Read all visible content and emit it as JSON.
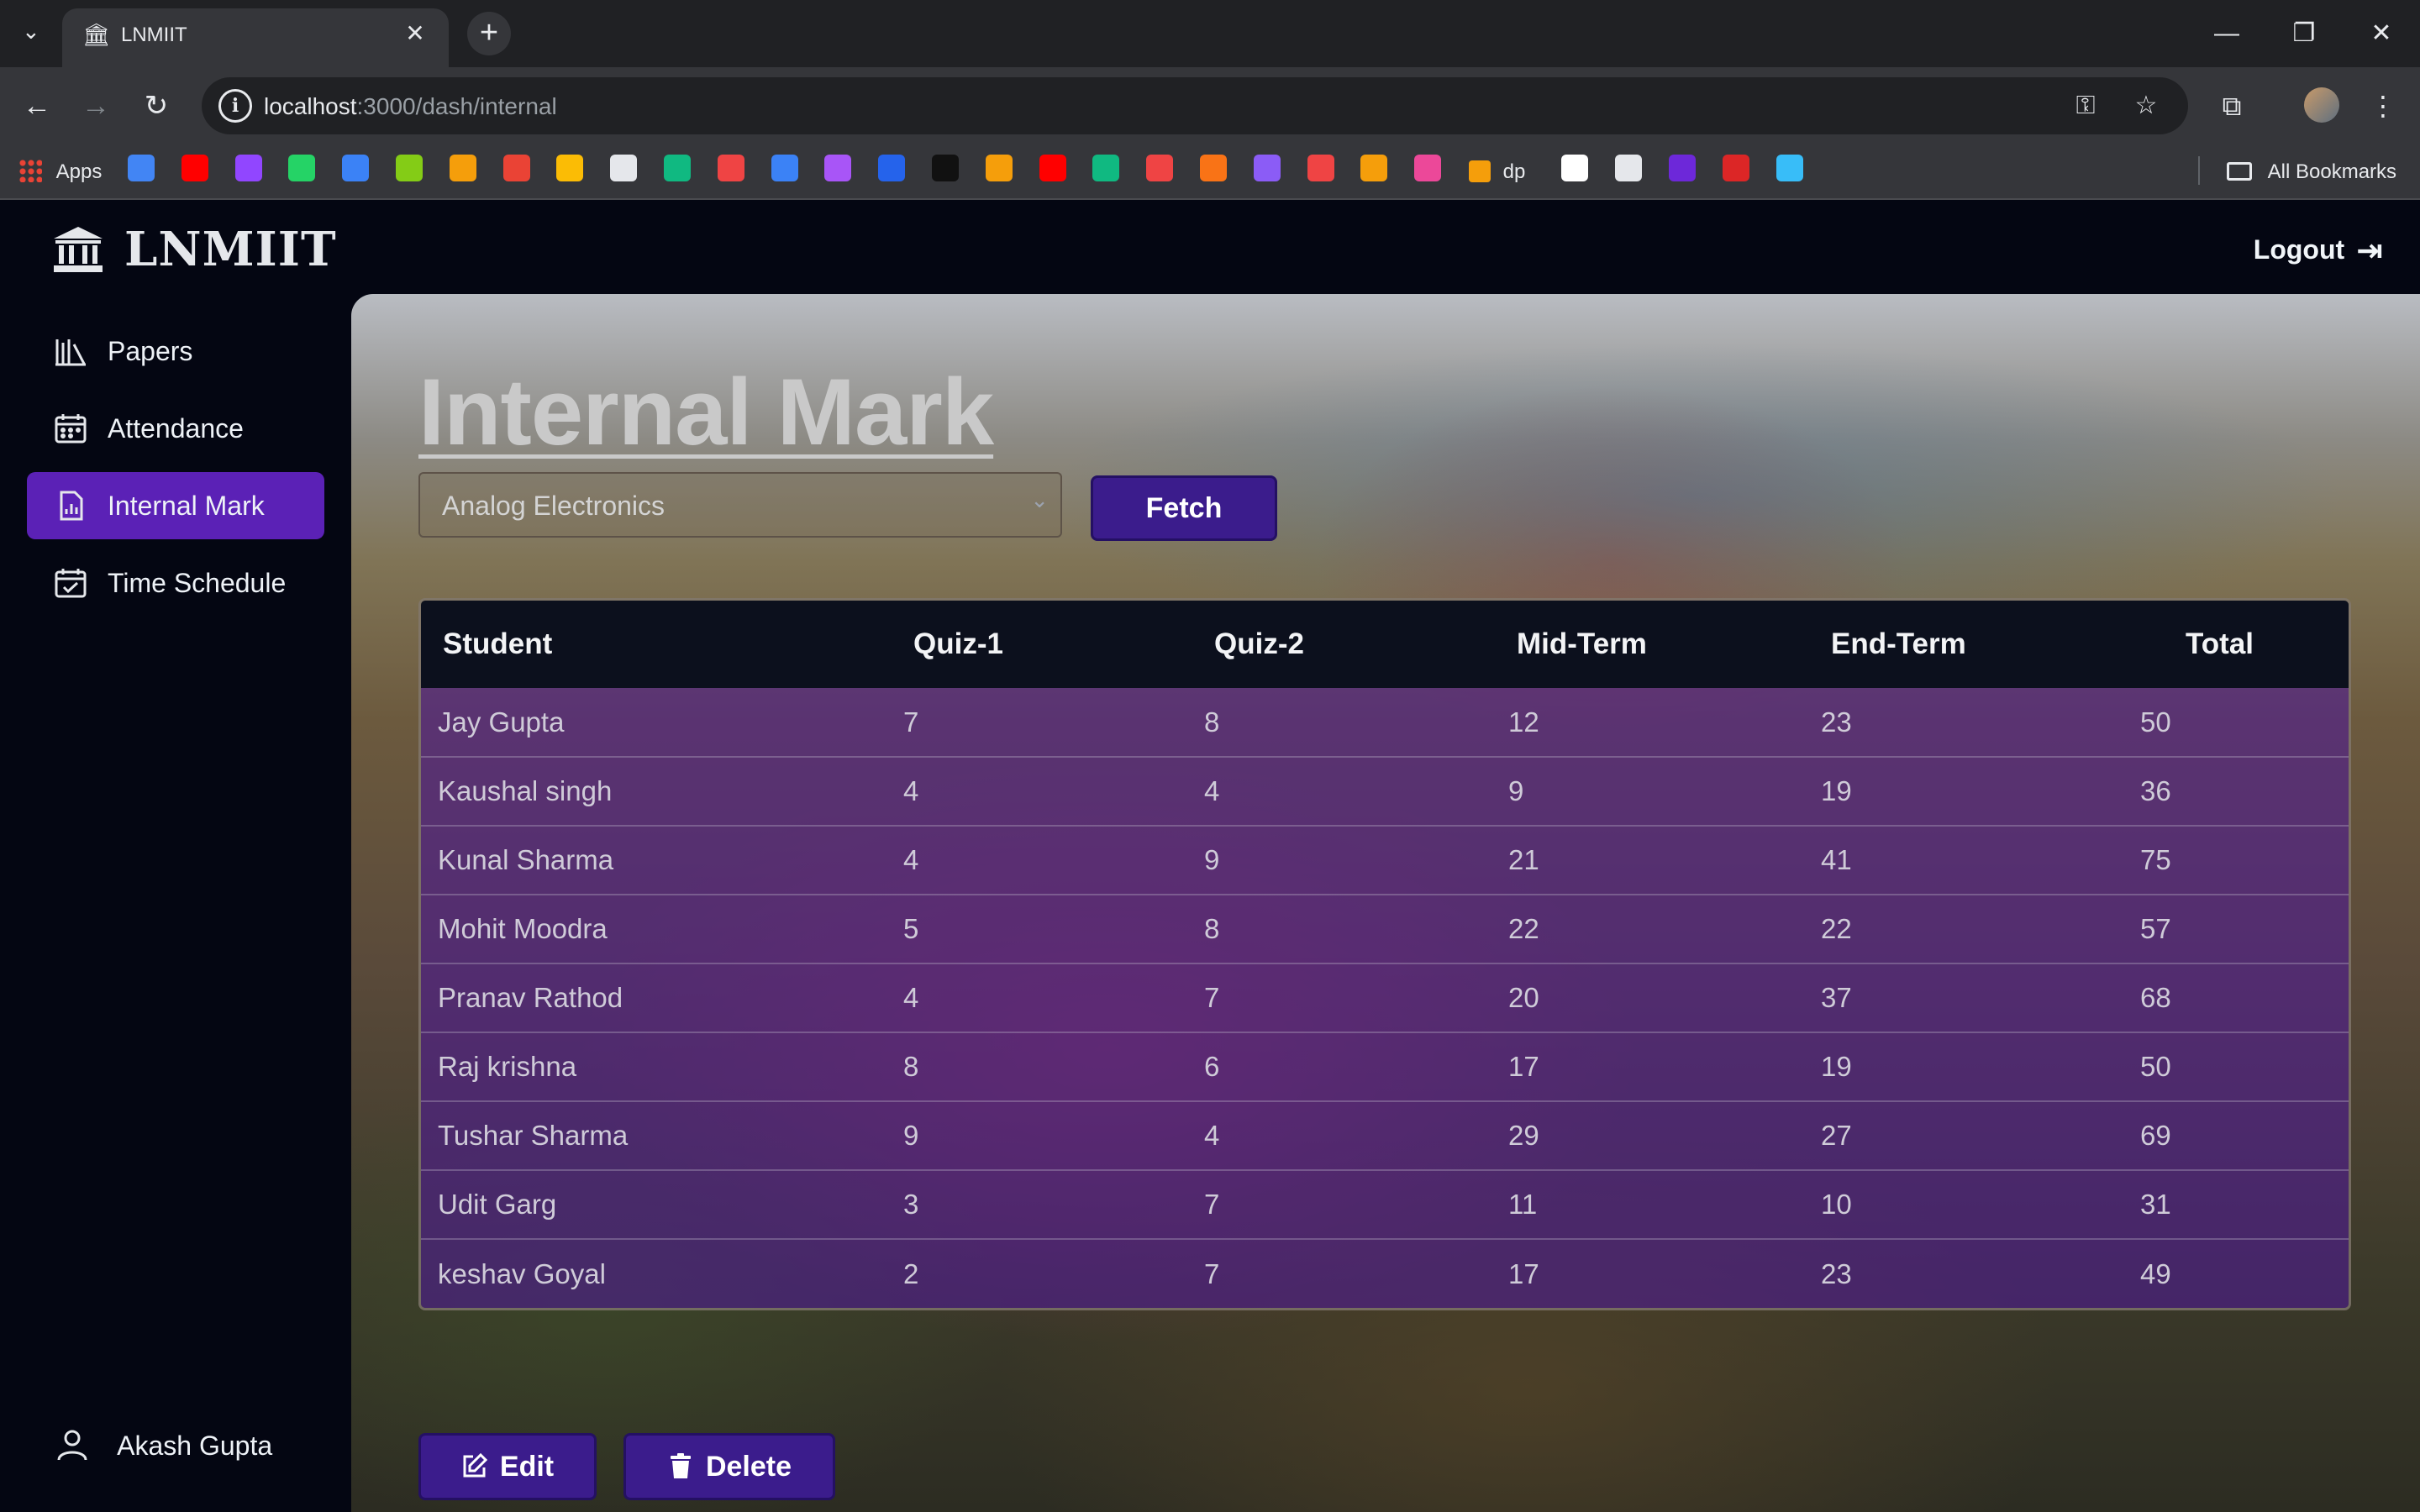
{
  "browser": {
    "tab_title": "LNMIIT",
    "tab_dropdown": "⌄",
    "url_host": "localhost",
    "url_path": ":3000/dash/internal",
    "bookmarks_apps": "Apps",
    "bookmark_dp": "dp",
    "all_bookmarks": "All Bookmarks"
  },
  "app": {
    "brand": "LNMIIT",
    "logout_label": "Logout"
  },
  "sidebar": {
    "items": [
      {
        "label": "Papers",
        "icon": "books-icon"
      },
      {
        "label": "Attendance",
        "icon": "calendar-icon"
      },
      {
        "label": "Internal Mark",
        "icon": "report-icon",
        "active": true
      },
      {
        "label": "Time Schedule",
        "icon": "schedule-icon"
      }
    ],
    "user_name": "Akash Gupta"
  },
  "main": {
    "title": "Internal Mark",
    "subject_selected": "Analog Electronics",
    "fetch_label": "Fetch",
    "edit_label": "Edit",
    "delete_label": "Delete"
  },
  "table": {
    "headers": [
      "Student",
      "Quiz-1",
      "Quiz-2",
      "Mid-Term",
      "End-Term",
      "Total"
    ],
    "rows": [
      [
        "Jay Gupta",
        "7",
        "8",
        "12",
        "23",
        "50"
      ],
      [
        "Kaushal singh",
        "4",
        "4",
        "9",
        "19",
        "36"
      ],
      [
        "Kunal Sharma",
        "4",
        "9",
        "21",
        "41",
        "75"
      ],
      [
        "Mohit Moodra",
        "5",
        "8",
        "22",
        "22",
        "57"
      ],
      [
        "Pranav Rathod",
        "4",
        "7",
        "20",
        "37",
        "68"
      ],
      [
        "Raj krishna",
        "8",
        "6",
        "17",
        "19",
        "50"
      ],
      [
        "Tushar Sharma",
        "9",
        "4",
        "29",
        "27",
        "69"
      ],
      [
        "Udit Garg",
        "3",
        "7",
        "11",
        "10",
        "31"
      ],
      [
        "keshav Goyal",
        "2",
        "7",
        "17",
        "23",
        "49"
      ]
    ]
  },
  "colors": {
    "accent": "#5b21b6",
    "button": "#3b1c8c",
    "background": "#040612"
  }
}
